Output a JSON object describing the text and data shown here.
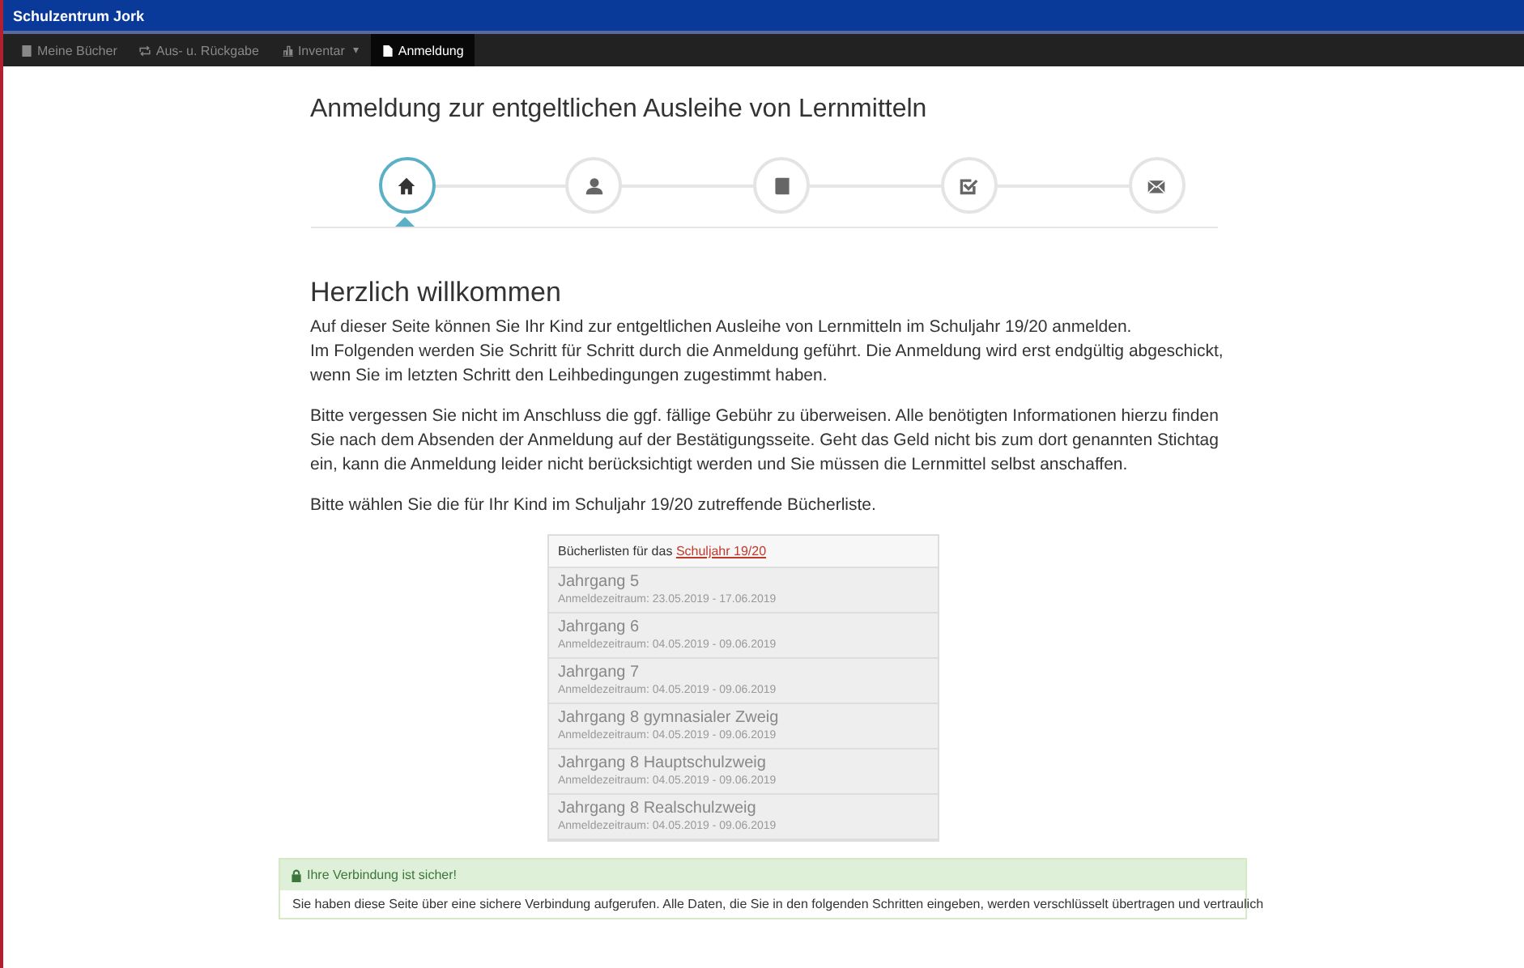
{
  "app_title": "Schulzentrum Jork",
  "nav": [
    {
      "label": "Meine Bücher",
      "kind": "book",
      "selected": false
    },
    {
      "label": "Aus- u. Rückgabe",
      "kind": "swap",
      "selected": false
    },
    {
      "label": "Inventar",
      "kind": "chart",
      "selected": false,
      "caret": "▾"
    },
    {
      "label": "Anmeldung",
      "kind": "file",
      "selected": true
    }
  ],
  "page_title": "Anmeldung zur entgeltlichen Ausleihe von Lernmitteln",
  "steps": [
    {
      "kind": "home",
      "selected": true
    },
    {
      "kind": "user",
      "selected": false
    },
    {
      "kind": "book",
      "selected": false
    },
    {
      "kind": "check",
      "selected": false
    },
    {
      "kind": "mail",
      "selected": false
    }
  ],
  "heading": "Herzlich willkommen",
  "paragraphs": [
    "Auf dieser Seite können Sie Ihr Kind zur entgeltlichen Ausleihe von Lernmitteln im Schuljahr 19/20 anmelden.\nIm Folgenden werden Sie Schritt für Schritt durch die Anmeldung geführt. Die Anmeldung wird erst endgültig abgeschickt, wenn Sie im letzten Schritt den Leihbedingungen zugestimmt haben.",
    "Bitte vergessen Sie nicht im Anschluss die ggf. fällige Gebühr zu überweisen. Alle benötigten Informationen hierzu finden Sie nach dem Absenden der Anmeldung auf der Bestätigungsseite. Geht das Geld nicht bis zum dort genannten Stichtag ein, kann die Anmeldung leider nicht berücksichtigt werden und Sie müssen die Lernmittel selbst anschaffen.",
    "Bitte wählen Sie die für Ihr Kind im Schuljahr 19/20 zutreffende Bücherliste."
  ],
  "book_lists": {
    "header": "Bücherlisten für das",
    "header_link": "Schuljahr 19/20",
    "items": [
      {
        "title": "Jahrgang 5",
        "period": "Anmeldezeitraum: 23.05.2019 - 17.06.2019"
      },
      {
        "title": "Jahrgang 6",
        "period": "Anmeldezeitraum: 04.05.2019 - 09.06.2019"
      },
      {
        "title": "Jahrgang 7",
        "period": "Anmeldezeitraum: 04.05.2019 - 09.06.2019"
      },
      {
        "title": "Jahrgang 8 gymnasialer Zweig",
        "period": "Anmeldezeitraum: 04.05.2019 - 09.06.2019"
      },
      {
        "title": "Jahrgang 8 Hauptschulzweig",
        "period": "Anmeldezeitraum: 04.05.2019 - 09.06.2019"
      },
      {
        "title": "Jahrgang 8 Realschulzweig",
        "period": "Anmeldezeitraum: 04.05.2019 - 09.06.2019"
      }
    ]
  },
  "security": {
    "title": "Ihre Verbindung ist sicher!",
    "text": "Sie haben diese Seite über eine sichere Verbindung aufgerufen. Alle Daten, die Sie in den folgenden Schritten eingeben, werden verschlüsselt übertragen und vertraulich"
  }
}
